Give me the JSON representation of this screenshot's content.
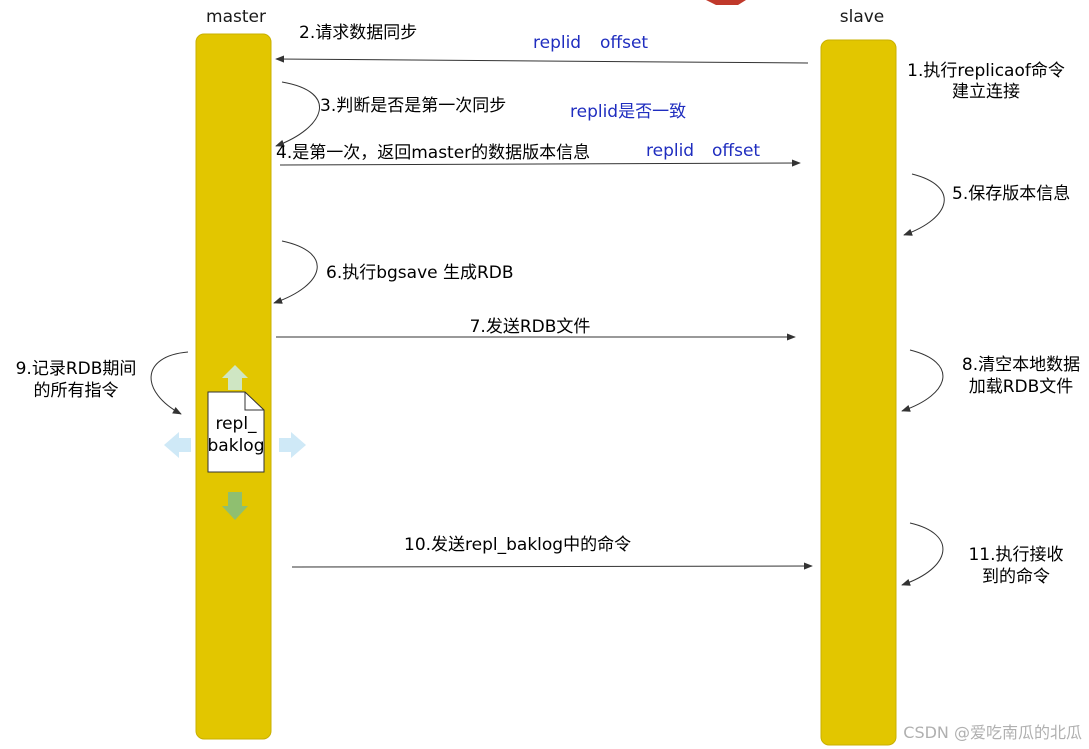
{
  "actors": {
    "master": "master",
    "slave": "slave"
  },
  "steps": {
    "s1_line1": "1.执行replicaof命令",
    "s1_line2": "建立连接",
    "s2": "2.请求数据同步",
    "s2_params": [
      "replid",
      "offset"
    ],
    "s3": "3.判断是否是第一次同步",
    "s3_note": "replid是否一致",
    "s4": "4.是第一次，返回master的数据版本信息",
    "s4_params": [
      "replid",
      "offset"
    ],
    "s5": "5.保存版本信息",
    "s6": "6.执行bgsave 生成RDB",
    "s7": "7.发送RDB文件",
    "s8_line1": "8.清空本地数据",
    "s8_line2": "加载RDB文件",
    "s9_line1": "9.记录RDB期间",
    "s9_line2": "的所有指令",
    "s10": "10.发送repl_baklog中的命令",
    "s11_line1": "11.执行接收",
    "s11_line2": "到的命令"
  },
  "buffer": {
    "line1": "repl_",
    "line2": "baklog"
  },
  "watermark": "CSDN @爱吃南瓜的北瓜",
  "colors": {
    "lifeline_fill": "#e2c600",
    "lifeline_stroke": "#c9b000",
    "param_text": "#1f2dbf",
    "arrow": "#333333",
    "ring_up": "#cfe6c3",
    "ring_down": "#8fbf70",
    "ring_side": "#cfe9f7",
    "top_mark": "#c0392b"
  },
  "icons": [
    "document-icon",
    "arrow-up-icon",
    "arrow-down-icon",
    "arrow-left-icon",
    "arrow-right-icon"
  ]
}
